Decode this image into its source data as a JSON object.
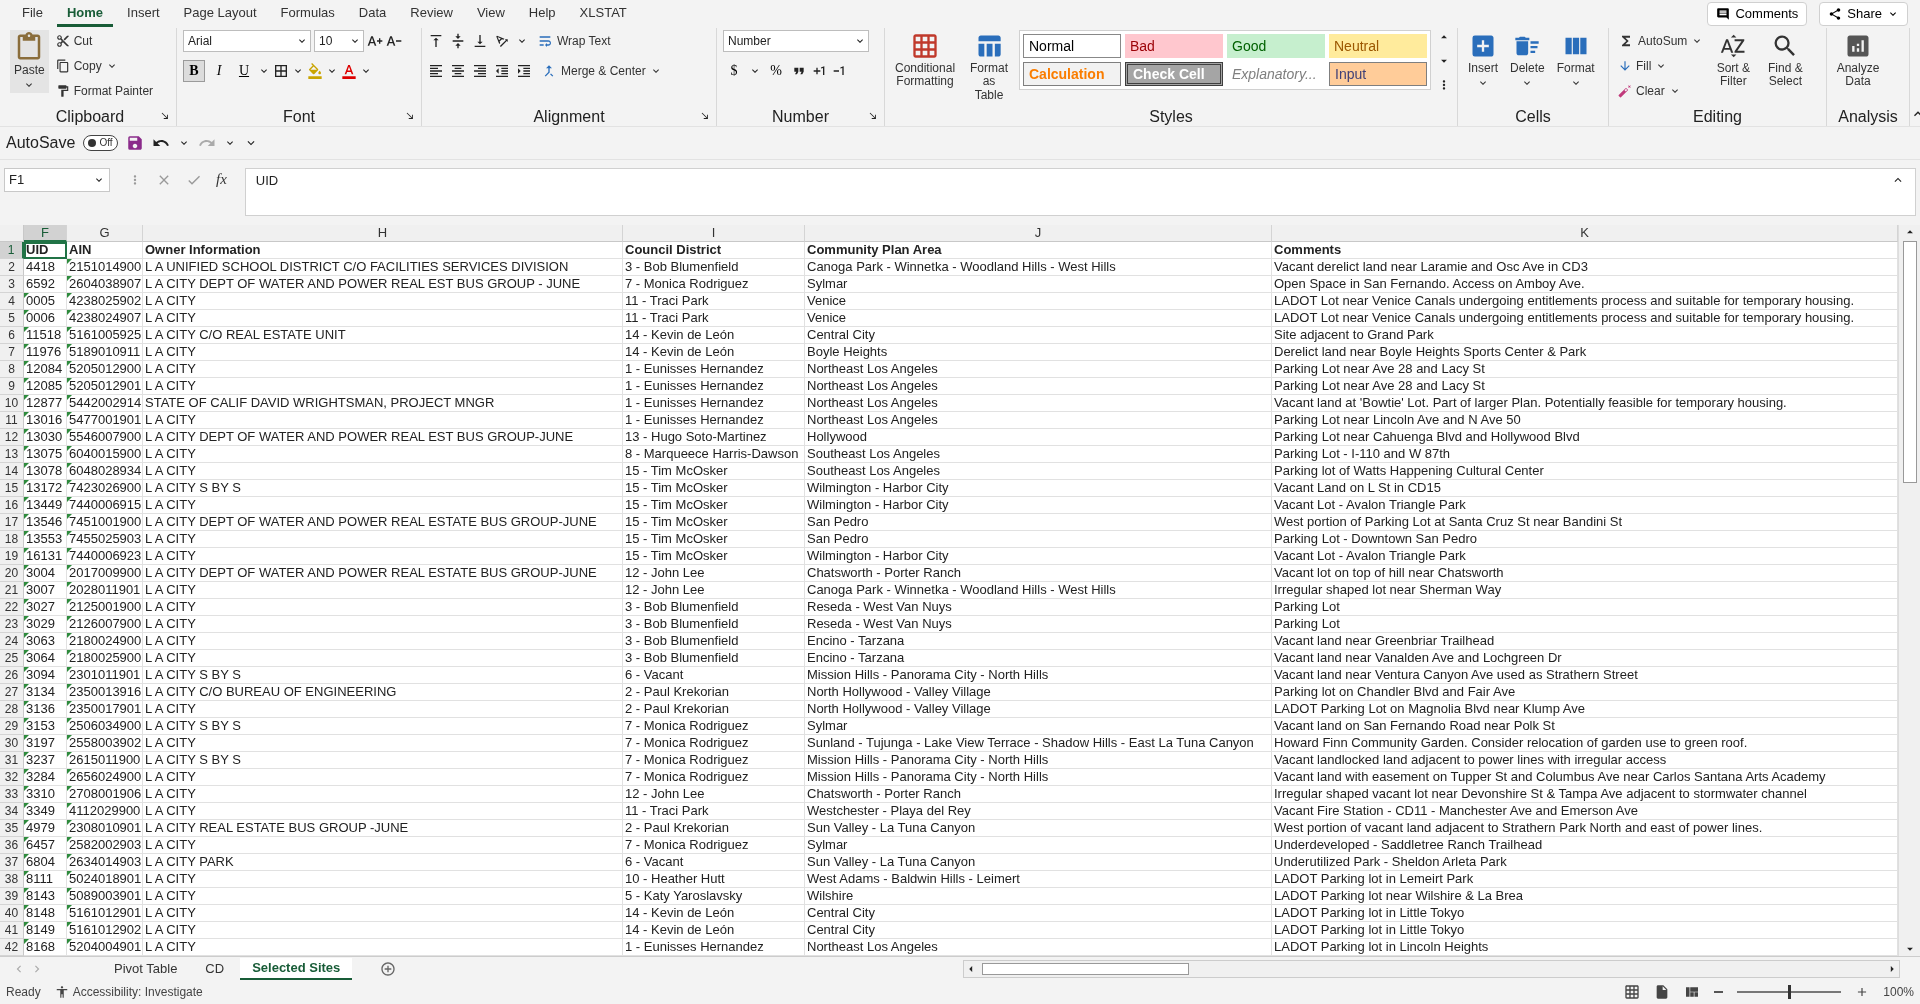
{
  "ribbon": {
    "tabs": [
      {
        "label": "File",
        "selected": false
      },
      {
        "label": "Home",
        "selected": true
      },
      {
        "label": "Insert",
        "selected": false
      },
      {
        "label": "Page Layout",
        "selected": false
      },
      {
        "label": "Formulas",
        "selected": false
      },
      {
        "label": "Data",
        "selected": false
      },
      {
        "label": "Review",
        "selected": false
      },
      {
        "label": "View",
        "selected": false
      },
      {
        "label": "Help",
        "selected": false
      },
      {
        "label": "XLSTAT",
        "selected": false
      }
    ],
    "comments": "Comments",
    "share": "Share",
    "clipboard": {
      "label": "Clipboard",
      "paste": "Paste",
      "cut": "Cut",
      "copy": "Copy",
      "format_painter": "Format Painter"
    },
    "font": {
      "label": "Font",
      "name": "Arial",
      "size": "10",
      "bold": "B",
      "italic": "I",
      "underline": "U"
    },
    "alignment": {
      "label": "Alignment",
      "wrap": "Wrap Text",
      "merge": "Merge & Center"
    },
    "number": {
      "label": "Number",
      "format": "Number",
      "currency": "$",
      "percent": "%"
    },
    "styles": {
      "label": "Styles",
      "conditional": "Conditional Formatting",
      "format_table": "Format as Table",
      "gallery": [
        {
          "label": "Normal",
          "kind": "normal"
        },
        {
          "label": "Bad",
          "kind": "bad"
        },
        {
          "label": "Good",
          "kind": "good"
        },
        {
          "label": "Neutral",
          "kind": "neutral"
        },
        {
          "label": "Calculation",
          "kind": "calculation"
        },
        {
          "label": "Check Cell",
          "kind": "check"
        },
        {
          "label": "Explanatory...",
          "kind": "explanatory"
        },
        {
          "label": "Input",
          "kind": "input"
        }
      ]
    },
    "cells": {
      "label": "Cells",
      "buttons": [
        "Insert",
        "Delete",
        "Format"
      ]
    },
    "editing": {
      "label": "Editing",
      "autosum": "AutoSum",
      "fill": "Fill",
      "clear": "Clear",
      "sort": "Sort & Filter",
      "find": "Find & Select"
    },
    "analysis": {
      "label": "Analysis",
      "analyze": "Analyze Data"
    }
  },
  "quick_access": {
    "autosave": "AutoSave",
    "toggle": {
      "label": "Off",
      "on": false
    }
  },
  "formula_bar": {
    "name_box": "F1",
    "fx": "fx",
    "value": "UID"
  },
  "sheet": {
    "columns": [
      {
        "label": "F",
        "selected": true
      },
      {
        "label": "G",
        "selected": false
      },
      {
        "label": "H",
        "selected": false
      },
      {
        "label": "I",
        "selected": false
      },
      {
        "label": "J",
        "selected": false
      },
      {
        "label": "K",
        "selected": false
      }
    ],
    "rows": [
      {
        "n": "1",
        "selected": true,
        "cells": [
          "UID",
          "AIN",
          "Owner Information",
          "Council District",
          "Community Plan Area",
          "Comments"
        ],
        "flags": [
          false,
          false
        ]
      },
      {
        "n": "2",
        "selected": false,
        "cells": [
          "4418",
          "2151014900",
          "L A UNIFIED SCHOOL DISTRICT C/O FACILITIES SERVICES DIVISION",
          "3 - Bob Blumenfield",
          "Canoga Park - Winnetka - Woodland Hills - West Hills",
          "Vacant derelict land near Laramie and Osc Ave in CD3"
        ],
        "flags": [
          false,
          true
        ]
      },
      {
        "n": "3",
        "selected": false,
        "cells": [
          "6592",
          "2604038907",
          "L A CITY DEPT OF WATER AND POWER REAL EST BUS GROUP - JUNE",
          "7 - Monica Rodriguez",
          "Sylmar",
          "Open Space in San Fernando. Access on Amboy Ave."
        ],
        "flags": [
          false,
          true
        ]
      },
      {
        "n": "4",
        "selected": false,
        "cells": [
          "0005",
          "4238025902",
          "L A CITY",
          "11 - Traci Park",
          "Venice",
          "LADOT Lot near Venice Canals undergoing entitlements process and suitable for temporary housing."
        ],
        "flags": [
          true,
          true
        ]
      },
      {
        "n": "5",
        "selected": false,
        "cells": [
          "0006",
          "4238024907",
          "L A CITY",
          "11 - Traci Park",
          "Venice",
          "LADOT Lot near Venice Canals undergoing entitlements process and suitable for temporary housing."
        ],
        "flags": [
          true,
          true
        ]
      },
      {
        "n": "6",
        "selected": false,
        "cells": [
          "11518",
          "5161005925",
          "L A CITY C/O REAL ESTATE UNIT",
          "14 - Kevin de León",
          "Central City",
          "Site adjacent to Grand Park"
        ],
        "flags": [
          true,
          true
        ]
      },
      {
        "n": "7",
        "selected": false,
        "cells": [
          "11976",
          "5189010911",
          "L A CITY",
          "14 - Kevin de León",
          "Boyle Heights",
          "Derelict land near Boyle Heights Sports Center & Park"
        ],
        "flags": [
          true,
          true
        ]
      },
      {
        "n": "8",
        "selected": false,
        "cells": [
          "12084",
          "5205012900",
          "L A CITY",
          "1 - Eunisses Hernandez",
          "Northeast Los Angeles",
          "Parking Lot near Ave 28 and Lacy St"
        ],
        "flags": [
          true,
          true
        ]
      },
      {
        "n": "9",
        "selected": false,
        "cells": [
          "12085",
          "5205012901",
          "L A CITY",
          "1 - Eunisses Hernandez",
          "Northeast Los Angeles",
          "Parking Lot near Ave 28 and Lacy St"
        ],
        "flags": [
          true,
          true
        ]
      },
      {
        "n": "10",
        "selected": false,
        "cells": [
          "12877",
          "5442002914",
          "STATE OF CALIF DAVID WRIGHTSMAN, PROJECT MNGR",
          "1 - Eunisses Hernandez",
          "Northeast Los Angeles",
          "Vacant land at 'Bowtie' Lot. Part of larger Plan. Potentially feasible for temporary housing."
        ],
        "flags": [
          true,
          true
        ]
      },
      {
        "n": "11",
        "selected": false,
        "cells": [
          "13016",
          "5477001901",
          "L A CITY",
          "1 - Eunisses Hernandez",
          "Northeast Los Angeles",
          "Parking Lot near Lincoln Ave and N Ave 50"
        ],
        "flags": [
          true,
          true
        ]
      },
      {
        "n": "12",
        "selected": false,
        "cells": [
          "13030",
          "5546007900",
          "L A CITY DEPT OF WATER AND POWER REAL EST BUS GROUP-JUNE",
          "13 - Hugo Soto-Martinez",
          "Hollywood",
          "Parking Lot near Cahuenga Blvd and Hollywood Blvd"
        ],
        "flags": [
          true,
          true
        ]
      },
      {
        "n": "13",
        "selected": false,
        "cells": [
          "13075",
          "6040015900",
          "L A CITY",
          "8 - Marqueece Harris-Dawson",
          "Southeast Los Angeles",
          "Parking Lot - I-110 and W 87th"
        ],
        "flags": [
          true,
          true
        ]
      },
      {
        "n": "14",
        "selected": false,
        "cells": [
          "13078",
          "6048028934",
          "L A CITY",
          "15 - Tim McOsker",
          "Southeast Los Angeles",
          "Parking lot of Watts Happening Cultural Center"
        ],
        "flags": [
          true,
          true
        ]
      },
      {
        "n": "15",
        "selected": false,
        "cells": [
          "13172",
          "7423026900",
          "L A CITY S BY S",
          "15 - Tim McOsker",
          "Wilmington - Harbor City",
          "Vacant Land on L St in CD15"
        ],
        "flags": [
          true,
          true
        ]
      },
      {
        "n": "16",
        "selected": false,
        "cells": [
          "13449",
          "7440006915",
          "L A CITY",
          "15 - Tim McOsker",
          "Wilmington - Harbor City",
          "Vacant Lot - Avalon Triangle Park"
        ],
        "flags": [
          true,
          true
        ]
      },
      {
        "n": "17",
        "selected": false,
        "cells": [
          "13546",
          "7451001900",
          "L A CITY DEPT OF WATER AND POWER REAL ESTATE BUS GROUP-JUNE",
          "15 - Tim McOsker",
          "San Pedro",
          "West portion of Parking Lot at Santa Cruz St near Bandini St"
        ],
        "flags": [
          true,
          true
        ]
      },
      {
        "n": "18",
        "selected": false,
        "cells": [
          "13553",
          "7455025903",
          "L A CITY",
          "15 - Tim McOsker",
          "San Pedro",
          "Parking Lot - Downtown San Pedro"
        ],
        "flags": [
          true,
          true
        ]
      },
      {
        "n": "19",
        "selected": false,
        "cells": [
          "16131",
          "7440006923",
          "L A CITY",
          "15 - Tim McOsker",
          "Wilmington - Harbor City",
          "Vacant Lot - Avalon Triangle Park"
        ],
        "flags": [
          true,
          true
        ]
      },
      {
        "n": "20",
        "selected": false,
        "cells": [
          "3004",
          "2017009900",
          "L A CITY DEPT OF WATER AND POWER REAL ESTATE BUS GROUP-JUNE",
          "12 - John Lee",
          "Chatsworth - Porter Ranch",
          "Vacant lot on top of hill near Chatsworth"
        ],
        "flags": [
          true,
          true
        ]
      },
      {
        "n": "21",
        "selected": false,
        "cells": [
          "3007",
          "2028011901",
          "L A CITY",
          "12 - John Lee",
          "Canoga Park - Winnetka - Woodland Hills - West Hills",
          "Irregular shaped lot near Sherman Way"
        ],
        "flags": [
          true,
          true
        ]
      },
      {
        "n": "22",
        "selected": false,
        "cells": [
          "3027",
          "2125001900",
          "L A CITY",
          "3 - Bob Blumenfield",
          "Reseda - West Van Nuys",
          "Parking Lot"
        ],
        "flags": [
          true,
          true
        ]
      },
      {
        "n": "23",
        "selected": false,
        "cells": [
          "3029",
          "2126007900",
          "L A CITY",
          "3 - Bob Blumenfield",
          "Reseda - West Van Nuys",
          "Parking Lot"
        ],
        "flags": [
          true,
          true
        ]
      },
      {
        "n": "24",
        "selected": false,
        "cells": [
          "3063",
          "2180024900",
          "L A CITY",
          "3 - Bob Blumenfield",
          "Encino - Tarzana",
          "Vacant land near Greenbriar Trailhead"
        ],
        "flags": [
          true,
          true
        ]
      },
      {
        "n": "25",
        "selected": false,
        "cells": [
          "3064",
          "2180025900",
          "L A CITY",
          "3 - Bob Blumenfield",
          "Encino - Tarzana",
          "Vacant land near Vanalden Ave and Lochgreen Dr"
        ],
        "flags": [
          true,
          true
        ]
      },
      {
        "n": "26",
        "selected": false,
        "cells": [
          "3094",
          "2301011901",
          "L A CITY S BY S",
          "6 - Vacant",
          "Mission Hills - Panorama City - North Hills",
          "Vacant land near Ventura Canyon Ave used as Strathern Street"
        ],
        "flags": [
          true,
          true
        ]
      },
      {
        "n": "27",
        "selected": false,
        "cells": [
          "3134",
          "2350013916",
          "L A CITY C/O BUREAU OF ENGINEERING",
          "2 - Paul Krekorian",
          "North Hollywood - Valley Village",
          "Parking lot on Chandler Blvd and Fair Ave"
        ],
        "flags": [
          true,
          true
        ]
      },
      {
        "n": "28",
        "selected": false,
        "cells": [
          "3136",
          "2350017901",
          "L A CITY",
          "2 - Paul Krekorian",
          "North Hollywood - Valley Village",
          "LADOT Parking Lot on Magnolia Blvd near Klump Ave"
        ],
        "flags": [
          true,
          true
        ]
      },
      {
        "n": "29",
        "selected": false,
        "cells": [
          "3153",
          "2506034900",
          "L A CITY S BY S",
          "7 - Monica Rodriguez",
          "Sylmar",
          "Vacant land on San Fernando Road near Polk St"
        ],
        "flags": [
          true,
          true
        ]
      },
      {
        "n": "30",
        "selected": false,
        "cells": [
          "3197",
          "2558003902",
          "L A CITY",
          "7 - Monica Rodriguez",
          "Sunland - Tujunga - Lake View Terrace - Shadow Hills - East La Tuna Canyon",
          "Howard Finn Community Garden. Consider relocation of garden use to green roof."
        ],
        "flags": [
          true,
          true
        ]
      },
      {
        "n": "31",
        "selected": false,
        "cells": [
          "3237",
          "2615011900",
          "L A CITY S BY S",
          "7 - Monica Rodriguez",
          "Mission Hills - Panorama City - North Hills",
          "Vacant landlocked land adjacent to power lines with irregular access"
        ],
        "flags": [
          true,
          true
        ]
      },
      {
        "n": "32",
        "selected": false,
        "cells": [
          "3284",
          "2656024900",
          "L A CITY",
          "7 - Monica Rodriguez",
          "Mission Hills - Panorama City - North Hills",
          "Vacant land with easement on Tupper St and Columbus Ave near Carlos Santana Arts Academy"
        ],
        "flags": [
          true,
          true
        ]
      },
      {
        "n": "33",
        "selected": false,
        "cells": [
          "3310",
          "2708001906",
          "L A CITY",
          "12 - John Lee",
          "Chatsworth - Porter Ranch",
          "Irregular shaped vacant lot near Devonshire St & Tampa Ave adjacent to stormwater channel"
        ],
        "flags": [
          true,
          true
        ]
      },
      {
        "n": "34",
        "selected": false,
        "cells": [
          "3349",
          "4112029900",
          "L A CITY",
          "11 - Traci Park",
          "Westchester - Playa del Rey",
          "Vacant Fire Station - CD11 - Manchester Ave and Emerson Ave"
        ],
        "flags": [
          true,
          true
        ]
      },
      {
        "n": "35",
        "selected": false,
        "cells": [
          "4979",
          "2308010901",
          "L A CITY REAL ESTATE BUS GROUP -JUNE",
          "2 - Paul Krekorian",
          "Sun Valley - La Tuna Canyon",
          "West portion of vacant land adjacent to Strathern Park North and east of power lines."
        ],
        "flags": [
          true,
          true
        ]
      },
      {
        "n": "36",
        "selected": false,
        "cells": [
          "6457",
          "2582002903",
          "L A CITY",
          "7 - Monica Rodriguez",
          "Sylmar",
          "Underdeveloped - Saddletree Ranch Trailhead"
        ],
        "flags": [
          true,
          true
        ]
      },
      {
        "n": "37",
        "selected": false,
        "cells": [
          "6804",
          "2634014903",
          "L A CITY PARK",
          "6 - Vacant",
          "Sun Valley - La Tuna Canyon",
          "Underutilized Park - Sheldon Arleta Park"
        ],
        "flags": [
          true,
          true
        ]
      },
      {
        "n": "38",
        "selected": false,
        "cells": [
          "8111",
          "5024018901",
          "L A CITY",
          "10 - Heather Hutt",
          "West Adams - Baldwin Hills - Leimert",
          "LADOT Parking lot in Lemeirt Park"
        ],
        "flags": [
          true,
          true
        ]
      },
      {
        "n": "39",
        "selected": false,
        "cells": [
          "8143",
          "5089003901",
          "L A CITY",
          "5 - Katy Yaroslavsky",
          "Wilshire",
          "LADOT Parking lot near Wilshire & La Brea"
        ],
        "flags": [
          true,
          true
        ]
      },
      {
        "n": "40",
        "selected": false,
        "cells": [
          "8148",
          "5161012901",
          "L A CITY",
          "14 - Kevin de León",
          "Central City",
          "LADOT Parking lot in Little Tokyo"
        ],
        "flags": [
          true,
          true
        ]
      },
      {
        "n": "41",
        "selected": false,
        "cells": [
          "8149",
          "5161012902",
          "L A CITY",
          "14 - Kevin de León",
          "Central City",
          "LADOT Parking lot in Little Tokyo"
        ],
        "flags": [
          true,
          true
        ]
      },
      {
        "n": "42",
        "selected": false,
        "cells": [
          "8168",
          "5204004901",
          "L A CITY",
          "1 - Eunisses Hernandez",
          "Northeast Los Angeles",
          "LADOT Parking lot in Lincoln Heights"
        ],
        "flags": [
          true,
          true
        ]
      }
    ]
  },
  "sheet_tabs": [
    {
      "label": "Pivot Table",
      "selected": false
    },
    {
      "label": "CD",
      "selected": false
    },
    {
      "label": "Selected Sites",
      "selected": true
    }
  ],
  "status_bar": {
    "ready": "Ready",
    "accessibility": "Accessibility: Investigate",
    "zoom": {
      "level": 0.5,
      "reading": "100%"
    }
  }
}
